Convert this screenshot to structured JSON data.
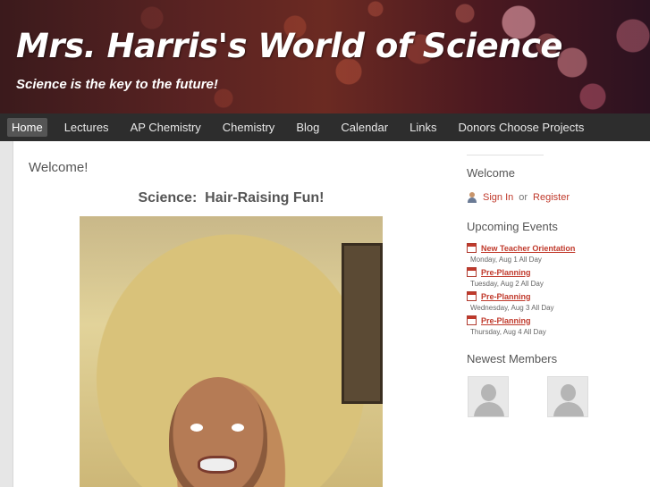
{
  "site": {
    "title": "Mrs. Harris's World of Science",
    "tagline": "Science is the key to the future!"
  },
  "nav": {
    "items": [
      "Home",
      "Lectures",
      "AP Chemistry",
      "Chemistry",
      "Blog",
      "Calendar",
      "Links",
      "Donors Choose Projects"
    ],
    "active": "Home"
  },
  "main": {
    "heading": "Welcome!",
    "post_title": "Science:  Hair-Raising Fun!"
  },
  "sidebar": {
    "welcome_heading": "Welcome",
    "sign_in": "Sign In",
    "or": "or",
    "register": "Register",
    "events_heading": "Upcoming Events",
    "events": [
      {
        "title": "New Teacher Orientation",
        "date": "Monday, Aug 1 All Day"
      },
      {
        "title": "Pre-Planning",
        "date": "Tuesday, Aug 2 All Day"
      },
      {
        "title": "Pre-Planning",
        "date": "Wednesday, Aug 3 All Day"
      },
      {
        "title": "Pre-Planning",
        "date": "Thursday, Aug 4 All Day"
      }
    ],
    "members_heading": "Newest Members"
  },
  "colors": {
    "accent": "#c0392b",
    "nav_bg": "#2d2d2d",
    "nav_active_bg": "#555555"
  },
  "icons": [
    "user-icon",
    "calendar-icon",
    "member-avatar-placeholder"
  ]
}
